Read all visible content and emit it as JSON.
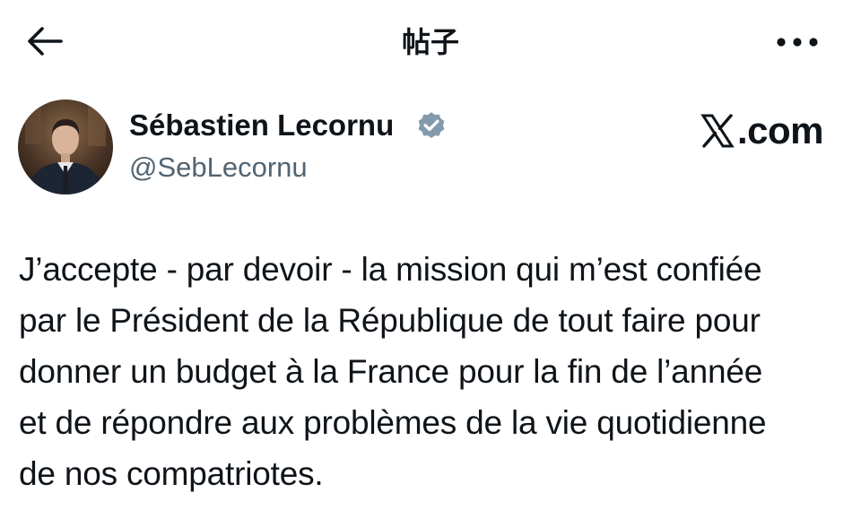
{
  "header": {
    "title": "帖子",
    "back_icon": "arrow-left-icon",
    "more_icon": "more-horizontal-icon"
  },
  "author": {
    "name": "Sébastien Lecornu",
    "handle": "@SebLecornu",
    "verified": true,
    "verified_icon": "verified-badge-icon",
    "badge_color": "#829aab"
  },
  "watermark": {
    "text": ".com",
    "logo_icon": "x-logo-icon"
  },
  "tweet": {
    "lines": [
      "J’accepte - par devoir - la mission qui m’est confiée",
      "par le Président de la République de tout faire pour",
      "donner un budget à la France pour la fin de l’année",
      "et de répondre aux problèmes de la vie quotidienne",
      "de nos compatriotes."
    ]
  }
}
